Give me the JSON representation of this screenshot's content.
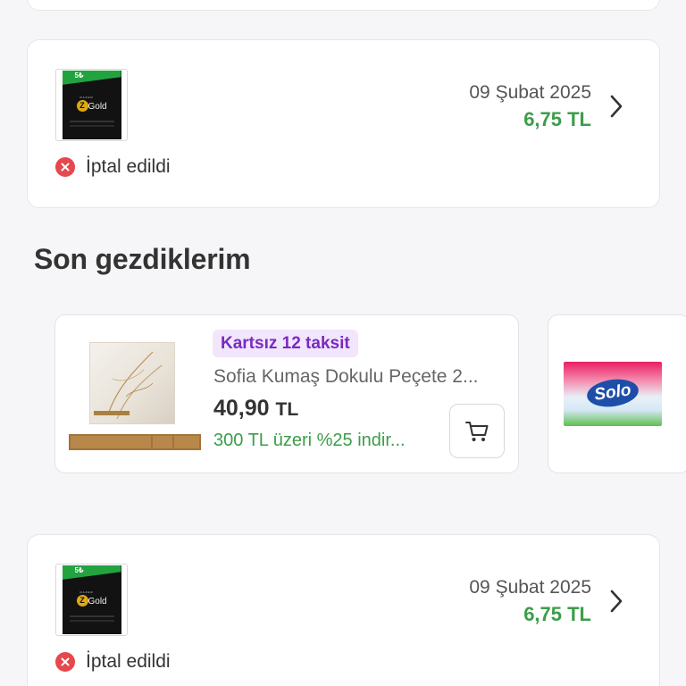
{
  "orders": [
    {
      "thumb": {
        "denom": "5₺",
        "brand": "Gold",
        "coin": "Z",
        "tag": "RAZER"
      },
      "status": "İptal edildi",
      "date": "09 Şubat 2025",
      "price": "6,75 TL"
    },
    {
      "thumb": {
        "denom": "5₺",
        "brand": "Gold",
        "coin": "Z",
        "tag": "RAZER"
      },
      "status": "İptal edildi",
      "date": "09 Şubat 2025",
      "price": "6,75 TL"
    }
  ],
  "recently_viewed": {
    "title": "Son gezdiklerim",
    "products": [
      {
        "badge": "Kartsız 12 taksit",
        "name": "Sofia Kumaş Dokulu Peçete 2...",
        "price": "40,90",
        "currency": "TL",
        "discount": "300 TL üzeri %25 indir..."
      },
      {
        "brand_logo": "Solo"
      }
    ]
  },
  "colors": {
    "price_green": "#3c9d4a",
    "cancel_red": "#e5484d",
    "badge_purple": "#7a2ac0",
    "badge_bg": "#f1e6fc"
  },
  "icons": {
    "status": "cancel-circle-icon",
    "nav": "chevron-right-icon",
    "cart": "shopping-cart-icon"
  }
}
